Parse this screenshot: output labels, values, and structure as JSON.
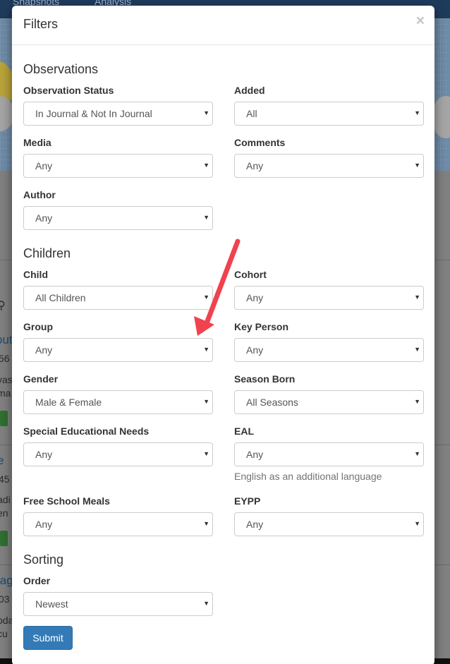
{
  "background": {
    "tabs": [
      "Snapshots",
      "Analysis"
    ],
    "fragments": {
      "f1": "out",
      "f2": "56",
      "f3": "vas",
      "f4": "ma",
      "f5": "r",
      "f6": "e",
      "f7": "45",
      "f8": "adi",
      "f9": "en",
      "f10": "r",
      "f11": "lag",
      "f12": "03",
      "f13": "oda",
      "f14": "cu"
    }
  },
  "modal": {
    "title": "Filters",
    "close_label": "×",
    "sections": {
      "observations": "Observations",
      "children": "Children",
      "sorting": "Sorting"
    },
    "fields": {
      "observation_status": {
        "label": "Observation Status",
        "value": "In Journal & Not In Journal"
      },
      "added": {
        "label": "Added",
        "value": "All"
      },
      "media": {
        "label": "Media",
        "value": "Any"
      },
      "comments": {
        "label": "Comments",
        "value": "Any"
      },
      "author": {
        "label": "Author",
        "value": "Any"
      },
      "child": {
        "label": "Child",
        "value": "All Children"
      },
      "cohort": {
        "label": "Cohort",
        "value": "Any"
      },
      "group": {
        "label": "Group",
        "value": "Any"
      },
      "key_person": {
        "label": "Key Person",
        "value": "Any"
      },
      "gender": {
        "label": "Gender",
        "value": "Male & Female"
      },
      "season_born": {
        "label": "Season Born",
        "value": "All Seasons"
      },
      "sen": {
        "label": "Special Educational Needs",
        "value": "Any"
      },
      "eal": {
        "label": "EAL",
        "value": "Any",
        "help": "English as an additional language"
      },
      "fsm": {
        "label": "Free School Meals",
        "value": "Any"
      },
      "eypp": {
        "label": "EYPP",
        "value": "Any"
      },
      "order": {
        "label": "Order",
        "value": "Newest"
      }
    },
    "submit_label": "Submit",
    "caret": "▼"
  },
  "colors": {
    "primary": "#337ab7",
    "annotation_arrow": "#f0424f"
  }
}
